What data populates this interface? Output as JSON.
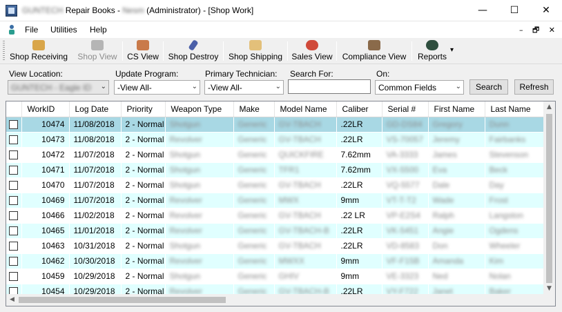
{
  "window": {
    "title_prefix_blurred": "GUNTECH",
    "title_app": "Repair Books - ",
    "title_user_blurred": "Nesm",
    "title_suffix": " (Administrator) - [Shop Work]",
    "minimize": "—",
    "maximize": "☐",
    "close": "✕"
  },
  "menu": {
    "file": "File",
    "utilities": "Utilities",
    "help": "Help",
    "mdi_min": "–",
    "mdi_restore": "🗗",
    "mdi_close": "✕"
  },
  "toolbar": {
    "shop_receiving": "Shop Receiving",
    "shop_view": "Shop View",
    "cs_view": "CS View",
    "shop_destroy": "Shop Destroy",
    "shop_shipping": "Shop Shipping",
    "sales_view": "Sales View",
    "compliance_view": "Compliance View",
    "reports": "Reports",
    "reports_arrow": "▾"
  },
  "filters": {
    "view_location_label": "View Location:",
    "view_location_value": "GUNTECH - Eagle ID",
    "update_program_label": "Update Program:",
    "update_program_value": "-View All-",
    "primary_tech_label": "Primary Technician:",
    "primary_tech_value": "-View All-",
    "search_for_label": "Search For:",
    "search_for_value": "",
    "on_label": "On:",
    "on_value": "Common Fields",
    "search_button": "Search",
    "refresh_button": "Refresh",
    "dropdown_arrow": "⌄"
  },
  "grid": {
    "columns": [
      "",
      "WorkID",
      "Log Date",
      "Priority",
      "Weapon Type",
      "Make",
      "Model Name",
      "Caliber",
      "Serial #",
      "First Name",
      "Last Name"
    ],
    "rows": [
      {
        "workid": "10474",
        "date": "11/08/2018",
        "priority": "2 - Normal",
        "weapon": "Shotgun",
        "make": "Generic",
        "model": "GV-TBACH",
        "caliber": ".22LR",
        "serial": "GD-DS84",
        "first": "Gregory",
        "last": "Dunn",
        "style": "sel"
      },
      {
        "workid": "10473",
        "date": "11/08/2018",
        "priority": "2 - Normal",
        "weapon": "Revolver",
        "make": "Generic",
        "model": "GV-TBACH",
        "caliber": ".22LR",
        "serial": "VS-70057",
        "first": "Jeremy",
        "last": "Fairbanks",
        "style": "b"
      },
      {
        "workid": "10472",
        "date": "11/07/2018",
        "priority": "2 - Normal",
        "weapon": "Shotgun",
        "make": "Generic",
        "model": "QUICKFIRE",
        "caliber": "7.62mm",
        "serial": "VA-3333",
        "first": "James",
        "last": "Stevenson",
        "style": "a"
      },
      {
        "workid": "10471",
        "date": "11/07/2018",
        "priority": "2 - Normal",
        "weapon": "Shotgun",
        "make": "Generic",
        "model": "TFR1",
        "caliber": "7.62mm",
        "serial": "VX-5500",
        "first": "Eva",
        "last": "Beck",
        "style": "b"
      },
      {
        "workid": "10470",
        "date": "11/07/2018",
        "priority": "2 - Normal",
        "weapon": "Shotgun",
        "make": "Generic",
        "model": "GV-TBACH",
        "caliber": ".22LR",
        "serial": "VQ-5577",
        "first": "Dale",
        "last": "Day",
        "style": "a"
      },
      {
        "workid": "10469",
        "date": "11/07/2018",
        "priority": "2 - Normal",
        "weapon": "Revolver",
        "make": "Generic",
        "model": "MWX",
        "caliber": "9mm",
        "serial": "VT-T-T2",
        "first": "Wade",
        "last": "Frost",
        "style": "b"
      },
      {
        "workid": "10466",
        "date": "11/02/2018",
        "priority": "2 - Normal",
        "weapon": "Revolver",
        "make": "Generic",
        "model": "GV-TBACH",
        "caliber": ".22 LR",
        "serial": "VP-E2S4",
        "first": "Ralph",
        "last": "Langston",
        "style": "a"
      },
      {
        "workid": "10465",
        "date": "11/01/2018",
        "priority": "2 - Normal",
        "weapon": "Revolver",
        "make": "Generic",
        "model": "GV-TBACH-B",
        "caliber": ".22LR",
        "serial": "VK-5451",
        "first": "Angie",
        "last": "Ogdens",
        "style": "b"
      },
      {
        "workid": "10463",
        "date": "10/31/2018",
        "priority": "2 - Normal",
        "weapon": "Shotgun",
        "make": "Generic",
        "model": "GV-TBACH",
        "caliber": ".22LR",
        "serial": "VD-8583",
        "first": "Don",
        "last": "Wheeler",
        "style": "a"
      },
      {
        "workid": "10462",
        "date": "10/30/2018",
        "priority": "2 - Normal",
        "weapon": "Revolver",
        "make": "Generic",
        "model": "MWXX",
        "caliber": "9mm",
        "serial": "VF-F15B",
        "first": "Amanda",
        "last": "Kim",
        "style": "b"
      },
      {
        "workid": "10459",
        "date": "10/29/2018",
        "priority": "2 - Normal",
        "weapon": "Shotgun",
        "make": "Generic",
        "model": "GHIV",
        "caliber": "9mm",
        "serial": "VE-3323",
        "first": "Ned",
        "last": "Nolan",
        "style": "a"
      },
      {
        "workid": "10454",
        "date": "10/29/2018",
        "priority": "2 - Normal",
        "weapon": "Revolver",
        "make": "Generic",
        "model": "GV-TBACH-B",
        "caliber": ".22LR",
        "serial": "VY-F722",
        "first": "Janet",
        "last": "Baker",
        "style": "b"
      }
    ]
  },
  "scroll": {
    "up": "▲",
    "down": "▼",
    "left": "◀",
    "right": "▶"
  }
}
